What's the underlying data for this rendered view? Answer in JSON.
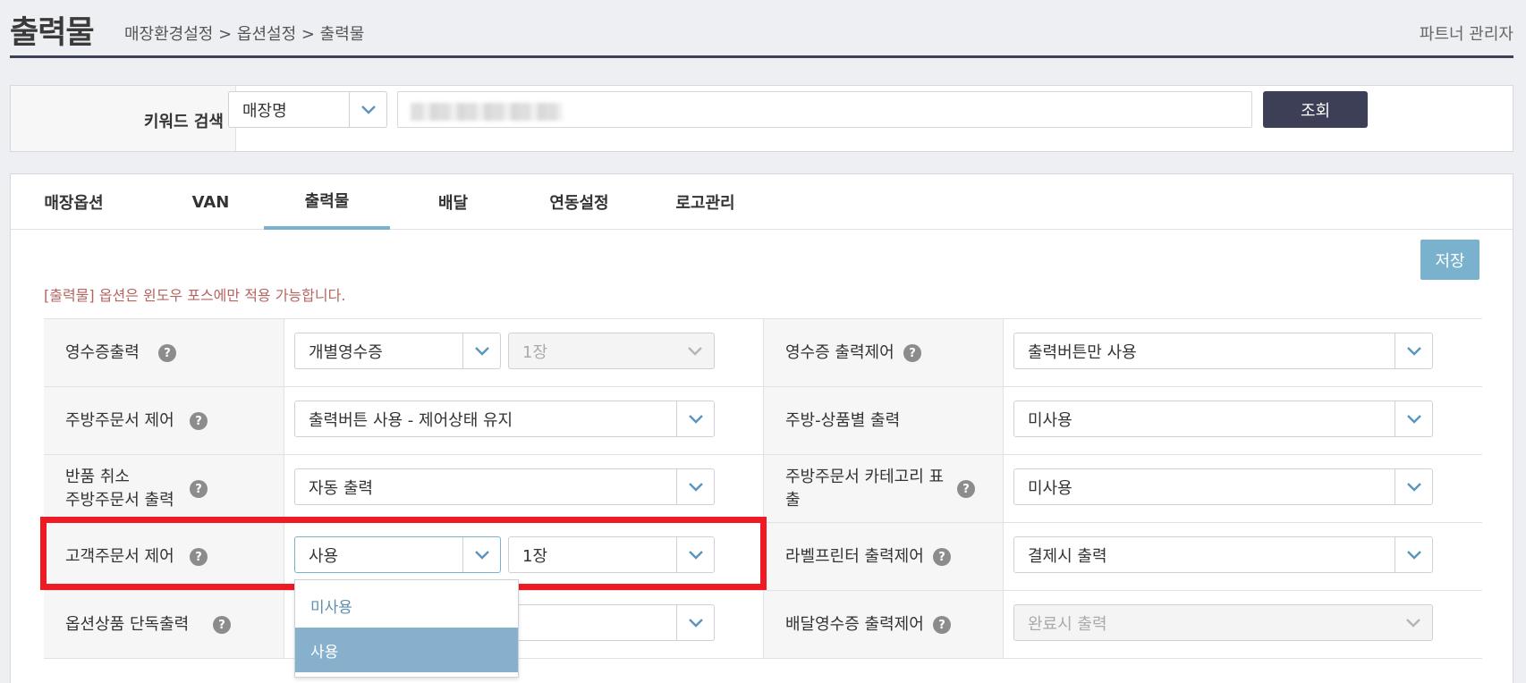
{
  "header": {
    "title": "출력물",
    "breadcrumb": "매장환경설정 > 옵션설정 > 출력물",
    "partner": "파트너 관리자"
  },
  "search": {
    "label": "키워드 검색",
    "type_value": "매장명",
    "button": "조회"
  },
  "tabs": [
    {
      "label": "매장옵션"
    },
    {
      "label": "VAN"
    },
    {
      "label": "출력물"
    },
    {
      "label": "배달"
    },
    {
      "label": "연동설정"
    },
    {
      "label": "로고관리"
    }
  ],
  "active_tab": "출력물",
  "save_button": "저장",
  "notice": "[출력물] 옵션은 윈도우 포스에만 적용 가능합니다.",
  "help_glyph": "?",
  "options": {
    "receipt_print": {
      "label": "영수증출력",
      "value": "개별영수증",
      "count": "1장"
    },
    "receipt_control": {
      "label": "영수증 출력제어",
      "value": "출력버튼만 사용"
    },
    "kitchen_control": {
      "label": "주방주문서 제어",
      "value": "출력버튼 사용 - 제어상태 유지"
    },
    "kitchen_by_product": {
      "label": "주방-상품별 출력",
      "value": "미사용"
    },
    "return_cancel": {
      "label_line1": "반품 취소",
      "label_line2": "주방주문서 출력",
      "value": "자동 출력"
    },
    "kitchen_category": {
      "label_line1": "주방주문서 카테고리 표",
      "label_line2": "출",
      "value": "미사용"
    },
    "customer_order": {
      "label": "고객주문서 제어",
      "value": "사용",
      "count": "1장"
    },
    "label_printer": {
      "label": "라벨프린터 출력제어",
      "value": "결제시 출력"
    },
    "option_single": {
      "label": "옵션상품 단독출력"
    },
    "delivery_receipt": {
      "label": "배달영수증 출력제어",
      "value": "완료시 출력"
    }
  },
  "dropdown": {
    "items": [
      "미사용",
      "사용"
    ],
    "selected": "사용"
  },
  "colors": {
    "primary_dark": "#3c3f55",
    "accent": "#7ab2cd",
    "highlight": "#ee1b24",
    "notice": "#b5655f"
  }
}
